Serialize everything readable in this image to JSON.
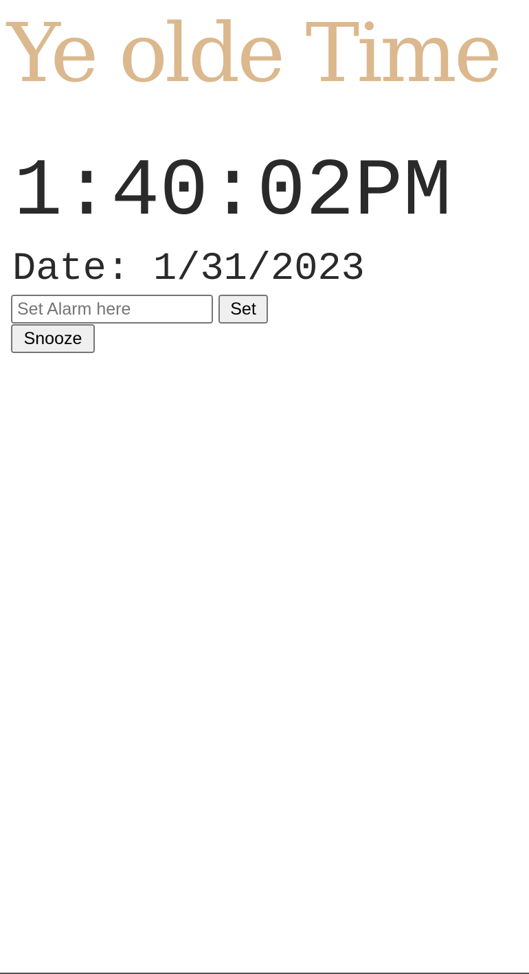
{
  "app": {
    "title": "Ye olde Time",
    "title_color": "#dbb88e"
  },
  "clock": {
    "time": "1:40:02PM",
    "date_label": "Date:",
    "date_value": "1/31/2023"
  },
  "alarm": {
    "input_placeholder": "Set Alarm here",
    "input_value": "",
    "set_label": "Set",
    "snooze_label": "Snooze"
  }
}
